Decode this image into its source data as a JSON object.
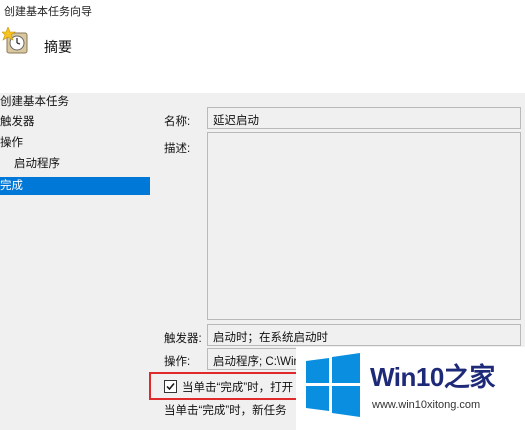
{
  "window": {
    "title": "创建基本任务向导"
  },
  "header": {
    "icon": "task-clock-icon",
    "title": "摘要"
  },
  "nav": {
    "items": [
      {
        "label": "创建基本任务",
        "selected": false,
        "sub": false
      },
      {
        "label": "触发器",
        "selected": false,
        "sub": false
      },
      {
        "label": "操作",
        "selected": false,
        "sub": false
      },
      {
        "label": "启动程序",
        "selected": false,
        "sub": true
      },
      {
        "label": "完成",
        "selected": true,
        "sub": false
      }
    ]
  },
  "form": {
    "name_label": "名称:",
    "name_value": "延迟启动",
    "desc_label": "描述:",
    "desc_value": "",
    "trigger_label": "触发器:",
    "trigger_value": "启动时；在系统启动时",
    "action_label": "操作:",
    "action_value": "启动程序; C:\\Win"
  },
  "open_properties": {
    "checked": true,
    "label": "当单击“完成”时，打开"
  },
  "footer_text": "当单击“完成”时，新任务",
  "watermark": {
    "brand": "Win10之家",
    "url": "www.win10xitong.com"
  },
  "colors": {
    "selection": "#0078d7",
    "highlight_box": "#e0292b",
    "window_bg": "#f0f0f0"
  }
}
